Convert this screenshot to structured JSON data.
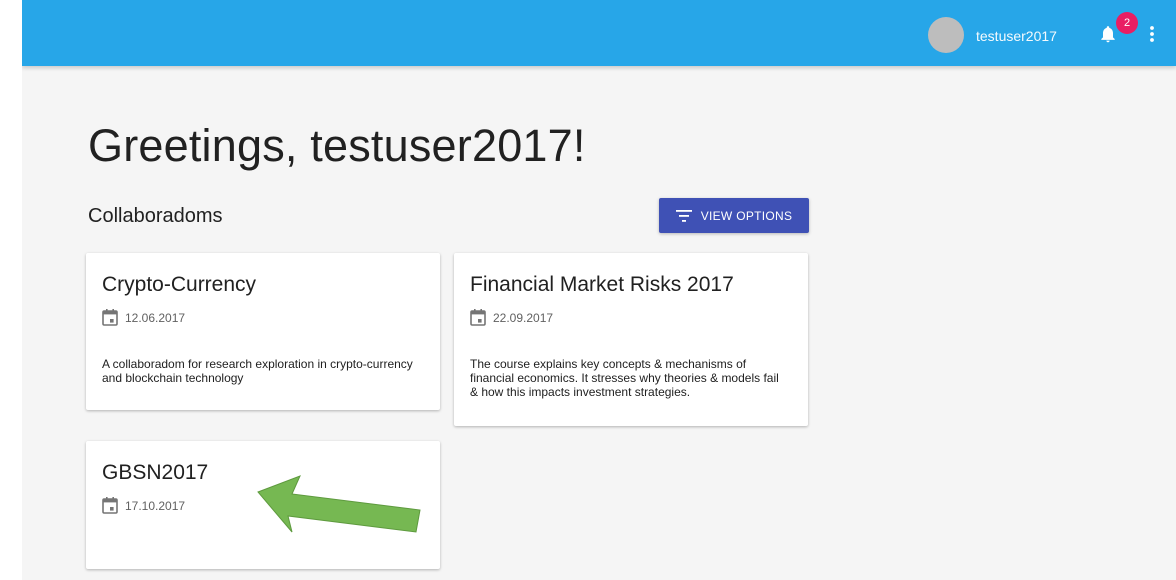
{
  "header": {
    "username": "testuser2017",
    "notification_count": "2",
    "colors": {
      "bar": "#27a6e8",
      "badge": "#e91e63"
    }
  },
  "main": {
    "greeting": "Greetings, testuser2017!",
    "section_title": "Collaboradoms",
    "view_options_label": "VIEW OPTIONS",
    "button_color": "#3f51b5"
  },
  "cards": [
    {
      "title": "Crypto-Currency",
      "date": "12.06.2017",
      "description": "A collaboradom for research exploration in crypto-currency and blockchain technology"
    },
    {
      "title": "Financial Market Risks 2017",
      "date": "22.09.2017",
      "description": "The course explains key concepts & mechanisms of financial economics. It stresses why theories & models fail & how this impacts investment strategies."
    },
    {
      "title": "GBSN2017",
      "date": "17.10.2017",
      "description": ""
    }
  ],
  "annotation": {
    "color": "#76b852",
    "icon": "arrow-icon"
  }
}
